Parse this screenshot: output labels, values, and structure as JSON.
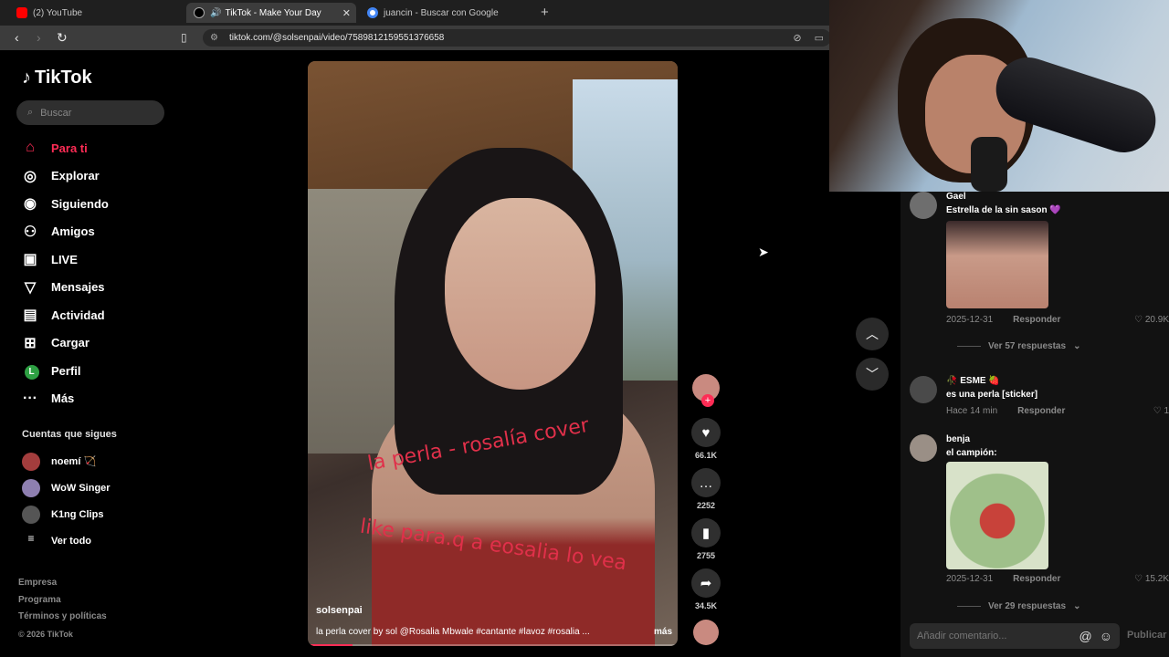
{
  "browser": {
    "tabs": [
      {
        "label": "(2) YouTube",
        "color": "#ff0000"
      },
      {
        "label": "TikTok - Make Your Day",
        "color": "#000000"
      },
      {
        "label": "juancin - Buscar con Google",
        "color": "#4285f4"
      }
    ],
    "url": "tiktok.com/@solsenpai/video/7589812159551376658"
  },
  "sidebar": {
    "logo": "TikTok",
    "search_placeholder": "Buscar",
    "menu": [
      {
        "label": "Para ti",
        "icon": "home-icon"
      },
      {
        "label": "Explorar",
        "icon": "compass-icon"
      },
      {
        "label": "Siguiendo",
        "icon": "following-icon"
      },
      {
        "label": "Amigos",
        "icon": "friends-icon"
      },
      {
        "label": "LIVE",
        "icon": "live-icon"
      },
      {
        "label": "Mensajes",
        "icon": "send-icon"
      },
      {
        "label": "Actividad",
        "icon": "activity-icon"
      },
      {
        "label": "Cargar",
        "icon": "upload-icon"
      },
      {
        "label": "Perfil",
        "icon": "profile-avatar"
      },
      {
        "label": "Más",
        "icon": "more-icon"
      }
    ],
    "profile_initial": "L",
    "following_title": "Cuentas que sigues",
    "following": [
      {
        "name": "noemí 🏹"
      },
      {
        "name": "WoW Singer"
      },
      {
        "name": "K1ng Clips"
      },
      {
        "name": "Ver todo"
      }
    ],
    "footer": [
      "Empresa",
      "Programa",
      "Términos y políticas",
      "© 2026 TikTok"
    ]
  },
  "video": {
    "overlay_line1": "la perla - rosalía cover",
    "overlay_line2": "like para.q a eosalia lo vea",
    "author": "solsenpai",
    "caption": "la perla cover by sol @Rosalia Mbwale #cantante #lavoz #rosalia ...",
    "more_label": "más",
    "progress": 0.12
  },
  "actions": {
    "plus": "+",
    "likes": "66.1K",
    "comments": "2252",
    "saves": "2755",
    "shares": "34.5K"
  },
  "comments": [
    {
      "name": "Gael",
      "text": "Estrella de la sin sason 💜",
      "date": "2025-12-31",
      "reply": "Responder",
      "likes": "20.9K",
      "replies": "Ver 57 respuestas"
    },
    {
      "name": "🥀 ESME 🍓",
      "text": "es una perla [sticker]",
      "date": "Hace 14 min",
      "reply": "Responder",
      "likes": "1"
    },
    {
      "name": "benja",
      "text": "el campión:",
      "date": "2025-12-31",
      "reply": "Responder",
      "likes": "15.2K",
      "replies": "Ver 29 respuestas"
    }
  ],
  "comment_input": {
    "placeholder": "Añadir comentario...",
    "publish": "Publicar"
  },
  "colors": {
    "accent": "#fe2c55"
  }
}
